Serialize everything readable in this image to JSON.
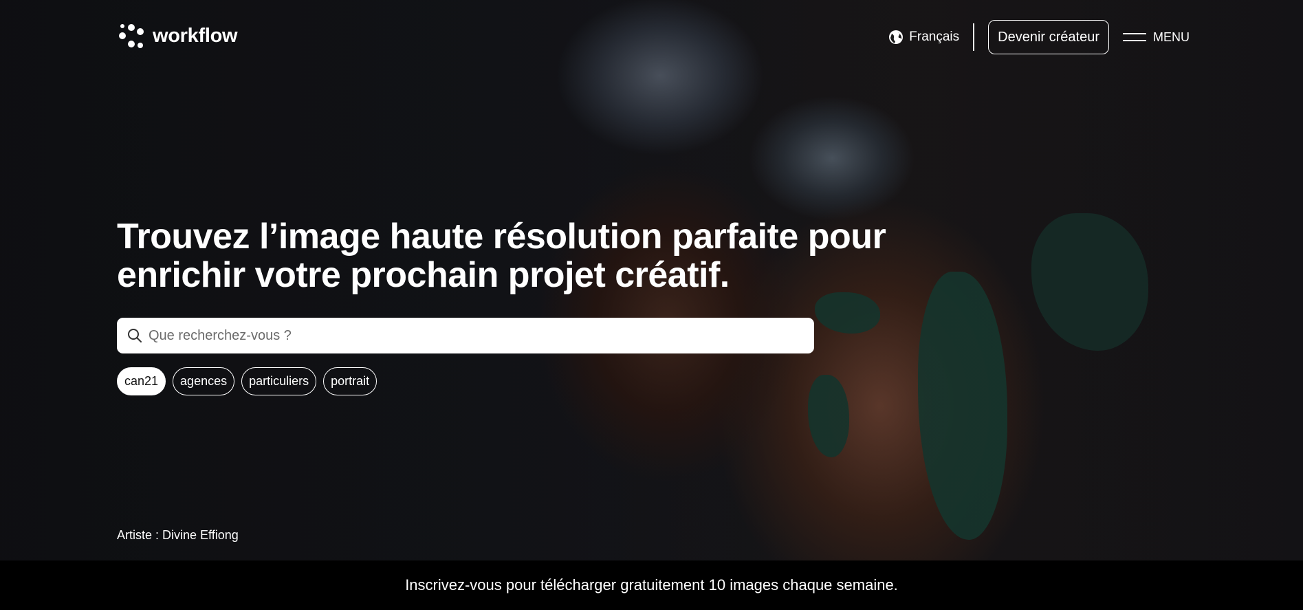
{
  "brand": {
    "name": "workflow"
  },
  "nav": {
    "language": "Français",
    "creator_button": "Devenir créateur",
    "menu_label": "MENU"
  },
  "hero": {
    "headline": "Trouvez l’image haute résolution parfaite pour enrichir votre prochain projet créatif.",
    "search": {
      "placeholder": "Que recherchez-vous ?",
      "value": ""
    },
    "tags": [
      {
        "label": "can21",
        "active": true
      },
      {
        "label": "agences",
        "active": false
      },
      {
        "label": "particuliers",
        "active": false
      },
      {
        "label": "portrait",
        "active": false
      }
    ],
    "artist_credit": "Artiste : Divine Effiong"
  },
  "banner": {
    "text": "Inscrivez-vous pour télécharger gratuitement 10 images chaque semaine."
  },
  "icons": {
    "logo": "workflow-logo-icon",
    "language": "globe-icon",
    "menu": "hamburger-icon",
    "search": "search-icon"
  },
  "colors": {
    "banner_bg": "#000000",
    "text": "#ffffff",
    "search_bg": "#ffffff"
  }
}
